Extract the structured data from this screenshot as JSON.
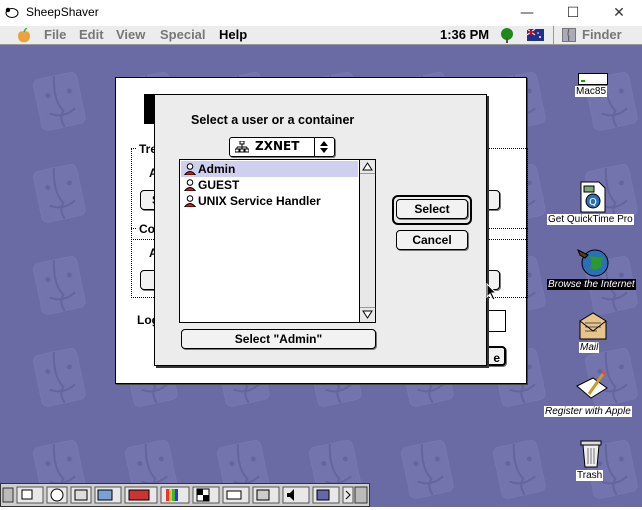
{
  "window": {
    "title": "SheepShaver",
    "controls": [
      "minimize-icon",
      "maximize-icon",
      "close-icon"
    ]
  },
  "menubar": {
    "apple_icon": "apple-menu-icon",
    "items": [
      "File",
      "Edit",
      "View",
      "Special",
      "Help"
    ],
    "active_item": "Help",
    "clock": "1:36 PM",
    "app_name": "Finder"
  },
  "background_dialog": {
    "labels": [
      "Tre",
      "A",
      "S",
      "Co",
      "A",
      "Log",
      "e"
    ]
  },
  "chooser_dialog": {
    "prompt": "Select a user or a container",
    "zone": "ZXNET",
    "list_items": [
      "Admin",
      "GUEST",
      "UNIX Service Handler"
    ],
    "selected_index": 0,
    "select_button": "Select",
    "cancel_button": "Cancel",
    "select_item_button": "Select \"Admin\""
  },
  "desktop_icons": [
    {
      "label": "Mac85",
      "icon": "hard-disk-icon"
    },
    {
      "label": "Get QuickTime Pro",
      "icon": "quicktime-movie-icon"
    },
    {
      "label": "Browse the Internet",
      "icon": "internet-globe-icon"
    },
    {
      "label": "Mail",
      "icon": "mail-icon"
    },
    {
      "label": "Register with Apple",
      "icon": "register-form-icon"
    },
    {
      "label": "Trash",
      "icon": "trash-icon"
    }
  ],
  "colors": {
    "desktop": "#6a6aa5",
    "selection": "#cfcfef"
  }
}
